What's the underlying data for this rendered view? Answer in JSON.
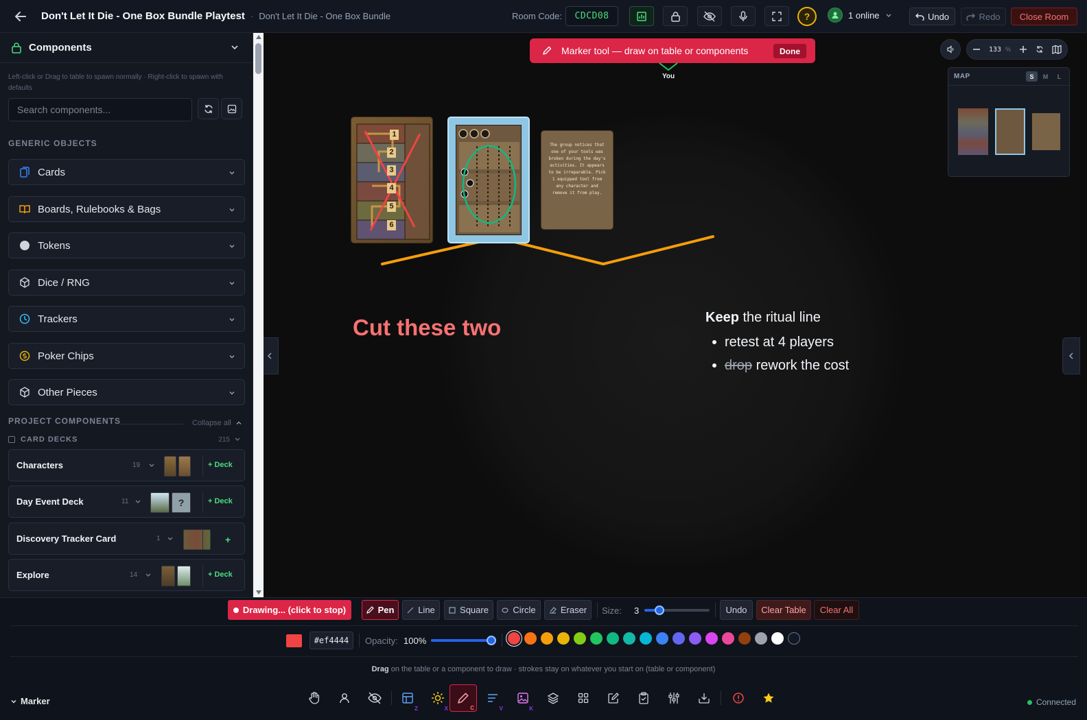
{
  "header": {
    "title": "Don't Let It Die - One Box Bundle Playtest",
    "separator": "·",
    "subtitle": "Don't Let It Die - One Box Bundle",
    "room_code_label": "Room Code:",
    "room_code": "CDCD08",
    "help": "?",
    "online": "1 online",
    "undo": "Undo",
    "redo": "Redo",
    "close_room": "Close Room"
  },
  "sidebar": {
    "title": "Components",
    "hint": "Left-click or Drag to table to spawn normally · Right-click to spawn with defaults",
    "search_placeholder": "Search components...",
    "generic_label": "GENERIC OBJECTS",
    "generic": [
      {
        "label": "Cards",
        "icon": "cards-icon",
        "color": "#3b82f6"
      },
      {
        "label": "Boards, Rulebooks & Bags",
        "icon": "book-icon",
        "color": "#f59e0b"
      },
      {
        "label": "Tokens",
        "icon": "token-icon",
        "color": "#d1d5db"
      },
      {
        "label": "Dice / RNG",
        "icon": "dice-icon",
        "color": "#cbd5e1"
      },
      {
        "label": "Trackers",
        "icon": "clock-icon",
        "color": "#38bdf8"
      },
      {
        "label": "Poker Chips",
        "icon": "coin-icon",
        "color": "#eab308"
      },
      {
        "label": "Other Pieces",
        "icon": "box-icon",
        "color": "#cbd5e1"
      }
    ],
    "project_label": "PROJECT COMPONENTS",
    "collapse_all": "Collapse all",
    "card_decks_label": "CARD DECKS",
    "card_decks_count": "215",
    "decks": [
      {
        "name": "Characters",
        "count": "19",
        "action": "Deck"
      },
      {
        "name": "Day Event Deck",
        "count": "11",
        "action": "Deck"
      },
      {
        "name": "Discovery Tracker Card",
        "count": "1",
        "action": ""
      },
      {
        "name": "Explore",
        "count": "14",
        "action": "Deck"
      }
    ]
  },
  "canvas": {
    "banner": "Marker tool — draw on table or components",
    "done": "Done",
    "you": "You",
    "card_c_text": "The group notices that one of your tools was broken during the day's activities. It appears to be irreparable. Pick 1 equipped tool from any character and remove it from play.",
    "card_a_numbers": [
      "1",
      "2",
      "3",
      "4",
      "5",
      "6"
    ],
    "cut_text": "Cut these two",
    "keep_bold": "Keep",
    "keep_rest": "the ritual line",
    "bullet1": "retest at 4 players",
    "bullet2_strike": "drop",
    "bullet2_rest": "rework the cost",
    "zoom_value": "133",
    "zoom_unit": "%",
    "minimap_title": "MAP",
    "minimap_sizes": [
      "S",
      "M",
      "L"
    ],
    "minimap_active_size": "S"
  },
  "bottom": {
    "drawing": "Drawing... (click to stop)",
    "pen": "Pen",
    "line": "Line",
    "square": "Square",
    "circle": "Circle",
    "eraser": "Eraser",
    "size_label": "Size:",
    "size_value": "3",
    "undo": "Undo",
    "clear_table": "Clear Table",
    "clear_all": "Clear All",
    "hex": "#ef4444",
    "current_color": "#ef4444",
    "opacity_label": "Opacity:",
    "opacity_value": "100%",
    "palette": [
      "#ef4444",
      "#f97316",
      "#f59e0b",
      "#eab308",
      "#84cc16",
      "#22c55e",
      "#10b981",
      "#14b8a6",
      "#06b6d4",
      "#3b82f6",
      "#6366f1",
      "#8b5cf6",
      "#d946ef",
      "#ec4899",
      "#92400e",
      "#9ca3af",
      "#ffffff",
      "#111827"
    ],
    "hint_bold": "Drag",
    "hint_rest": "on the table or a component to draw · strokes stay on whatever you start on (table or component)",
    "mode": "Marker",
    "dock_keys": [
      "Z",
      "X",
      "C",
      "V",
      "K"
    ],
    "connected": "Connected"
  }
}
